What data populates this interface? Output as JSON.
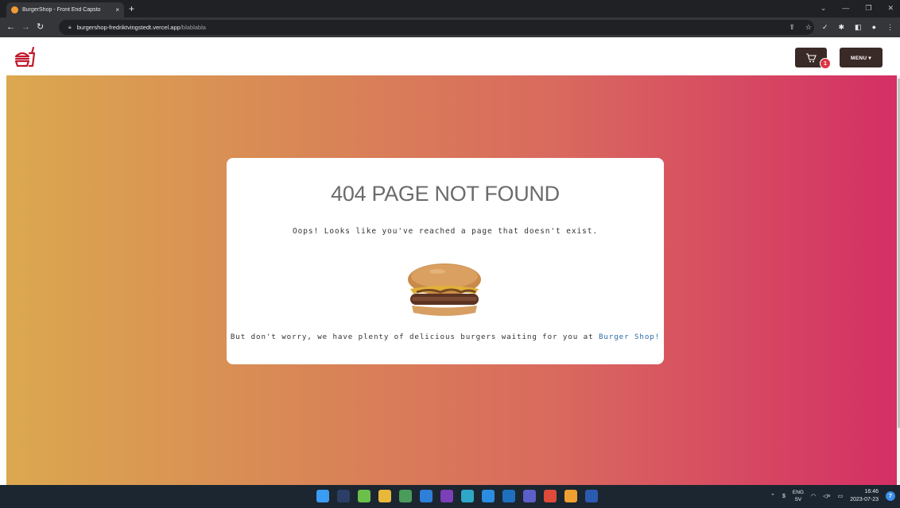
{
  "browser": {
    "tab_title": "BurgerShop - Front End Capsto",
    "tab_close": "×",
    "new_tab": "+",
    "url_host": "burgershop-fredriktvingstedt.vercel.app",
    "url_path": "/blablabla"
  },
  "header": {
    "cart_count": "1",
    "menu_label": "MENU ▾"
  },
  "error_card": {
    "title": "404 PAGE NOT FOUND",
    "message": "Oops! Looks like you've reached a page that doesn't exist.",
    "promo_text": "But don't worry, we have plenty of delicious burgers waiting for you at ",
    "promo_link": "Burger Shop!"
  },
  "taskbar": {
    "lang_top": "ENG",
    "lang_bottom": "SV",
    "time": "16:46",
    "date": "2023-07-23",
    "notification_count": "7"
  },
  "colors": {
    "gradient_start": "#dba84f",
    "gradient_end": "#d42f65",
    "brand_dark": "#3a2a27",
    "logo_red": "#c0182c",
    "link_blue": "#2b6ca8",
    "badge_red": "#dc3545"
  }
}
